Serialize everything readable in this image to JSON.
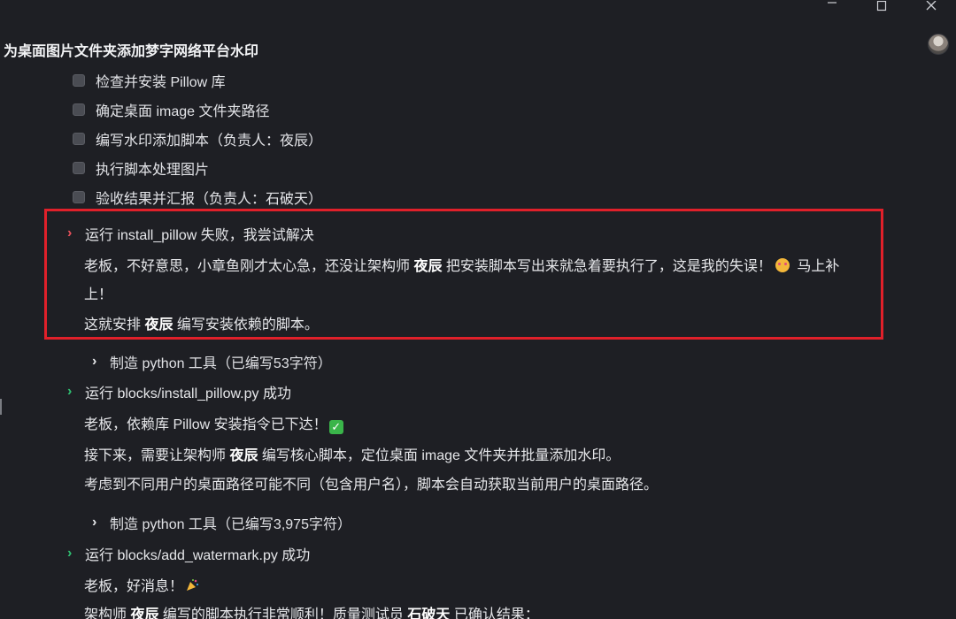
{
  "window": {
    "title": "为桌面图片文件夹添加梦字网络平台水印",
    "controls": [
      "minimize",
      "maximize",
      "close"
    ]
  },
  "tasks": [
    {
      "text": "检查并安装 Pillow 库"
    },
    {
      "text": "确定桌面 image 文件夹路径"
    },
    {
      "text": "编写水印添加脚本（负责人：夜辰）"
    },
    {
      "text": "执行脚本处理图片"
    },
    {
      "text": "验收结果并汇报（负责人：石破天）"
    }
  ],
  "run1": {
    "label": "运行 install_pillow 失败，我尝试解决",
    "status": "failed",
    "p1_before": "老板，不好意思，小章鱼刚才太心急，还没让架构师 ",
    "p1_bold": "夜辰",
    "p1_after": " 把安装脚本写出来就急着要执行了，这是我的失误！",
    "p1_end_a": " 马上补",
    "p1_end_b": "上！",
    "p2_before": "这就安排 ",
    "p2_bold": "夜辰",
    "p2_after": " 编写安装依赖的脚本。"
  },
  "tool1": {
    "label": "制造 python 工具（已编写53字符）"
  },
  "run2": {
    "label": "运行 blocks/install_pillow.py 成功",
    "status": "success",
    "l1": "老板，依赖库 Pillow 安装指令已下达！",
    "l2_before": "接下来，需要让架构师 ",
    "l2_bold": "夜辰",
    "l2_after": " 编写核心脚本，定位桌面 image 文件夹并批量添加水印。",
    "l3": "考虑到不同用户的桌面路径可能不同（包含用户名），脚本会自动获取当前用户的桌面路径。"
  },
  "tool2": {
    "label": "制造 python 工具（已编写3,975字符）"
  },
  "run3": {
    "label": "运行 blocks/add_watermark.py 成功",
    "status": "success",
    "l1": "老板，好消息！",
    "l2_a": "架构师 ",
    "l2_b": "夜辰",
    "l2_c": " 编写的脚本执行非常顺利！质量测试员 ",
    "l2_d": "石破天",
    "l2_e": " 已确认结果："
  },
  "colors": {
    "background": "#1e1f24",
    "highlight_border": "#e0202a",
    "fail_chevron": "#e8505a",
    "success_chevron": "#2fbf71"
  }
}
